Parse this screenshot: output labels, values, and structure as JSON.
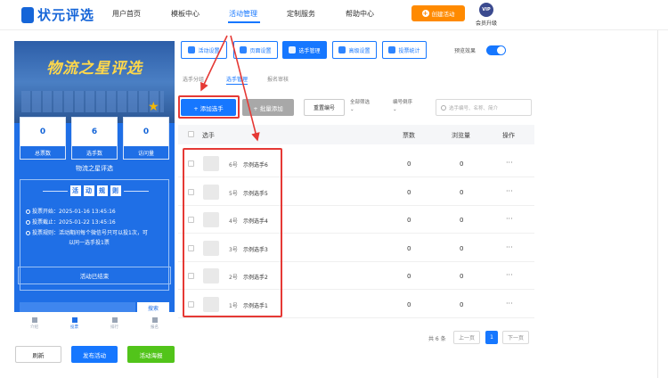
{
  "topnav": {
    "logo": "状元评选",
    "items": [
      "用户首页",
      "模板中心",
      "活动管理",
      "定制服务",
      "帮助中心"
    ],
    "create_button": "创建活动",
    "vip_badge": "VIP",
    "vip_label": "会员升级"
  },
  "preview": {
    "banner_title": "物流之星评选",
    "stats": [
      {
        "value": "0",
        "label": "总票数"
      },
      {
        "value": "6",
        "label": "选手数"
      },
      {
        "value": "0",
        "label": "访问量"
      }
    ],
    "activity_name": "物流之星评选",
    "rules_title": [
      "活",
      "动",
      "规",
      "则"
    ],
    "rules": [
      "投票开始：2025-01-16 13:45:16",
      "投票截止：2025-01-22 13:45:16",
      "投票规则：活动期间每个微信号只可以投1次，可",
      "以同一选手投1票"
    ],
    "ended_text": "活动已结束",
    "search_button": "搜索",
    "tabbar": [
      "介绍",
      "投票",
      "排行",
      "报名"
    ]
  },
  "bottom_buttons": {
    "refresh": "刷新",
    "publish": "发布活动",
    "poster": "活动海报"
  },
  "toolbar": {
    "buttons": [
      "活动设置",
      "页面设置",
      "选手管理",
      "高级设置",
      "投票统计"
    ],
    "preview_effect": "预览效果"
  },
  "subtabs": [
    "选手分组",
    "选手管理",
    "报名审核"
  ],
  "actions": {
    "add": "+ 添加选手",
    "batch_add": "+ 批量添加",
    "reset_no": "重置编号",
    "filter_all": "全部筛选",
    "sort_no": "编号倒序",
    "search_placeholder": "选手编号、名称、简介"
  },
  "table": {
    "headers": [
      "选手",
      "票数",
      "浏览量",
      "操作"
    ],
    "rows": [
      {
        "no": "6号",
        "name": "示例选手6",
        "votes": "0",
        "views": "0",
        "more": "···"
      },
      {
        "no": "5号",
        "name": "示例选手5",
        "votes": "0",
        "views": "0",
        "more": "···"
      },
      {
        "no": "4号",
        "name": "示例选手4",
        "votes": "0",
        "views": "0",
        "more": "···"
      },
      {
        "no": "3号",
        "name": "示例选手3",
        "votes": "0",
        "views": "0",
        "more": "···"
      },
      {
        "no": "2号",
        "name": "示例选手2",
        "votes": "0",
        "views": "0",
        "more": "···"
      },
      {
        "no": "1号",
        "name": "示例选手1",
        "votes": "0",
        "views": "0",
        "more": "···"
      }
    ]
  },
  "pager": {
    "total": "共 6 条",
    "prev": "上一页",
    "page": "1",
    "next": "下一页"
  },
  "colors": {
    "primary": "#1677ff",
    "orange": "#ff8a00",
    "annotation": "#e53935",
    "green": "#52c41a"
  }
}
